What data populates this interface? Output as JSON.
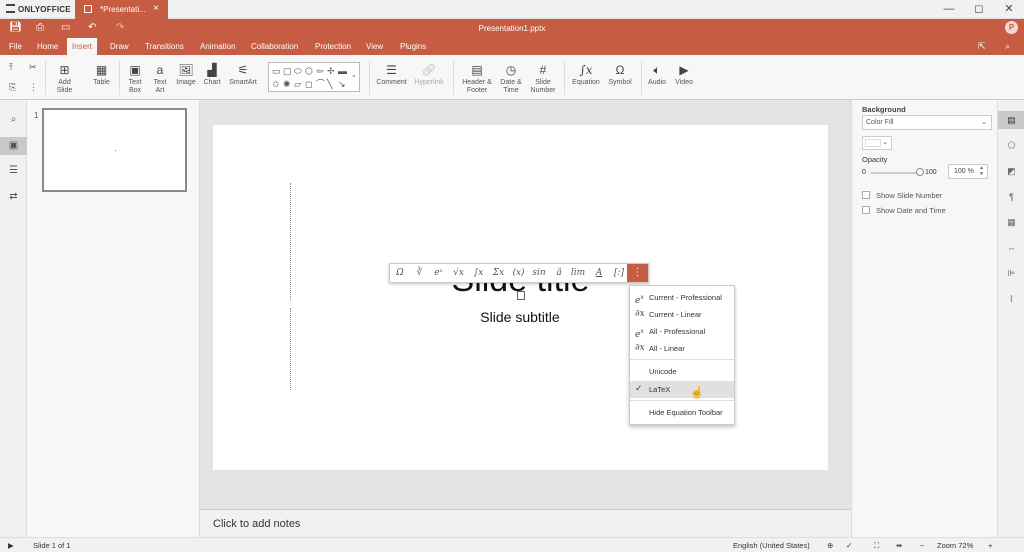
{
  "titlebar": {
    "brand": "ONLYOFFICE",
    "doc_tab_label": "*Presentati...",
    "doc_tab_close": "×",
    "win_min": "—",
    "win_max": "◻",
    "win_close": "✕"
  },
  "header": {
    "doc_title": "Presentation1.pptx",
    "avatar_initial": "P"
  },
  "menu": {
    "tabs": [
      "File",
      "Home",
      "Insert",
      "Draw",
      "Transitions",
      "Animation",
      "Collaboration",
      "Protection",
      "View",
      "Plugins"
    ],
    "active": "Insert"
  },
  "toolbar": {
    "add_slide": [
      "Add",
      "Slide"
    ],
    "table": "Table",
    "text_box": [
      "Text",
      "Box"
    ],
    "text_art": [
      "Text",
      "Art"
    ],
    "image": "Image",
    "chart": "Chart",
    "smartart": "SmartArt",
    "comment": "Comment",
    "hyperlink": "Hyperlink",
    "header_footer": [
      "Header &",
      "Footer"
    ],
    "date_time": [
      "Date &",
      "Time"
    ],
    "slide_number": [
      "Slide",
      "Number"
    ],
    "equation": "Equation",
    "symbol": "Symbol",
    "audio": "Audio",
    "video": "Video"
  },
  "slides_panel": {
    "slide_number": "1"
  },
  "slide": {
    "title": "Slide title",
    "subtitle": "Slide subtitle"
  },
  "equation_toolbar": {
    "buttons": [
      "Ω",
      "∛",
      "eˣ",
      "√x",
      "∫x",
      "Σx",
      "(x)",
      "sin",
      "ä",
      "lim",
      "A",
      "[:]"
    ],
    "more": "⋮"
  },
  "equation_menu": {
    "items": [
      {
        "icon": "e^x",
        "label": "Current - Professional"
      },
      {
        "icon": "∂x",
        "label": "Current - Linear"
      },
      {
        "icon": "e^x",
        "label": "All - Professional"
      },
      {
        "icon": "∂x",
        "label": "All - Linear"
      },
      {
        "icon": "",
        "label": "Unicode"
      },
      {
        "icon": "✓",
        "label": "LaTeX"
      },
      {
        "icon": "",
        "label": "Hide Equation Toolbar"
      }
    ],
    "selected": "LaTeX"
  },
  "notes": {
    "placeholder": "Click to add notes"
  },
  "right_panel": {
    "background_label": "Background",
    "fill_value": "Color Fill",
    "opacity_label": "Opacity",
    "slider_min": "0",
    "slider_max": "100",
    "opacity_value": "100 %",
    "opacity_fraction": 1.0,
    "show_slide_number": "Show Slide Number",
    "show_date_time": "Show Date and Time",
    "fill_color": "#ffffff"
  },
  "status": {
    "slide_position": "Slide 1 of 1",
    "language": "English (United States)",
    "zoom": "Zoom 72%"
  },
  "colors": {
    "accent": "#c65c41",
    "selected_item_bg": "#e0e0e0"
  }
}
